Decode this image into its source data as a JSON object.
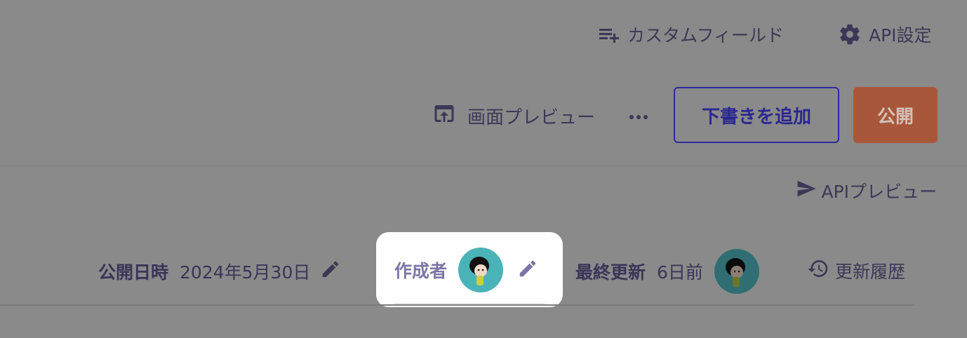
{
  "header": {
    "custom_field_label": "カスタムフィールド",
    "api_settings_label": "API設定"
  },
  "toolbar": {
    "screen_preview_label": "画面プレビュー",
    "more_label": "…",
    "add_draft_label": "下書きを追加",
    "publish_label": "公開"
  },
  "api_preview": {
    "label": "APIプレビュー"
  },
  "meta": {
    "published_label": "公開日時",
    "published_value": "2024年5月30日",
    "author_label": "作成者",
    "last_updated_label": "最終更新",
    "last_updated_value": "6日前",
    "history_label": "更新履歴"
  },
  "colors": {
    "overlay_bg": "#8a8a8a",
    "draft_border": "#2e2a9e",
    "publish_bg": "#a9573a",
    "author_label": "#7a76a4",
    "avatar_bg": "#4ab3b8"
  },
  "icons": {
    "custom_field": "playlist-add-icon",
    "api_settings": "gear-icon",
    "screen_preview": "open-in-browser-icon",
    "more": "more-horizontal-icon",
    "api_preview": "send-icon",
    "edit": "pencil-icon",
    "history": "history-icon"
  }
}
